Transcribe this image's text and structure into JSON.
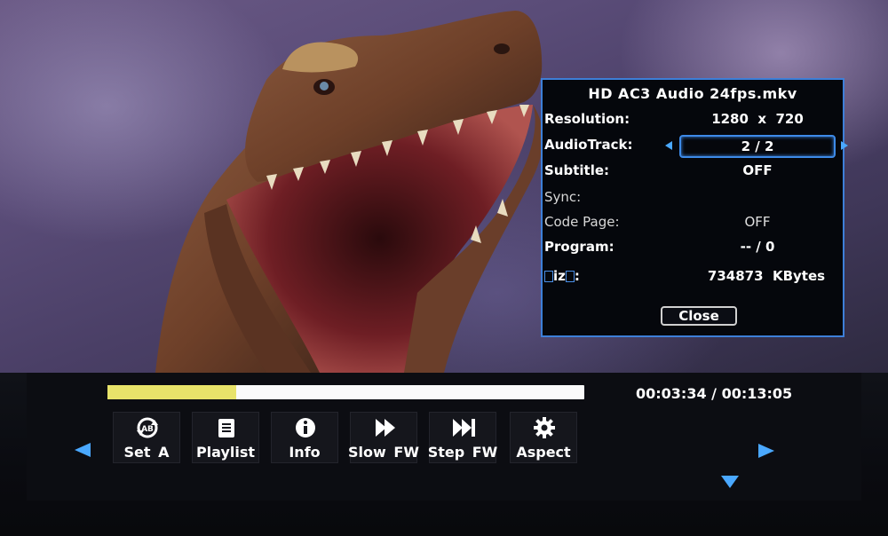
{
  "video": {
    "subject": "dinosaur"
  },
  "info_dialog": {
    "title": "HD AC3 Audio 24fps.mkv",
    "rows": [
      {
        "label": "Resolution:",
        "value": "1280  x  720"
      },
      {
        "label": "AudioTrack:",
        "value": "2 / 2"
      },
      {
        "label": "Subtitle:",
        "value": "OFF"
      },
      {
        "label": "Sync:",
        "value": ""
      },
      {
        "label": "Code Page:",
        "value": "OFF"
      },
      {
        "label": "Program:",
        "value": "-- / 0"
      },
      {
        "label_prefix": "iz",
        "label_suffix": ":",
        "value": "734873  KBytes"
      }
    ],
    "close_label": "Close"
  },
  "playback": {
    "progress_fraction": 0.27,
    "time": "00:03:34 / 00:13:05"
  },
  "toolbar": {
    "buttons": [
      {
        "label": "Set A",
        "icon": "ab-repeat-icon"
      },
      {
        "label": "Playlist",
        "icon": "playlist-icon"
      },
      {
        "label": "Info",
        "icon": "info-icon"
      },
      {
        "label": "Slow FW",
        "icon": "slow-forward-icon"
      },
      {
        "label": "Step FW",
        "icon": "step-forward-icon"
      },
      {
        "label": "Aspect",
        "icon": "gear-icon"
      }
    ]
  },
  "colors": {
    "accent": "#3d7fd8",
    "progress_fill": "#e8e36a",
    "nav_arrow": "#4aa8ff"
  }
}
